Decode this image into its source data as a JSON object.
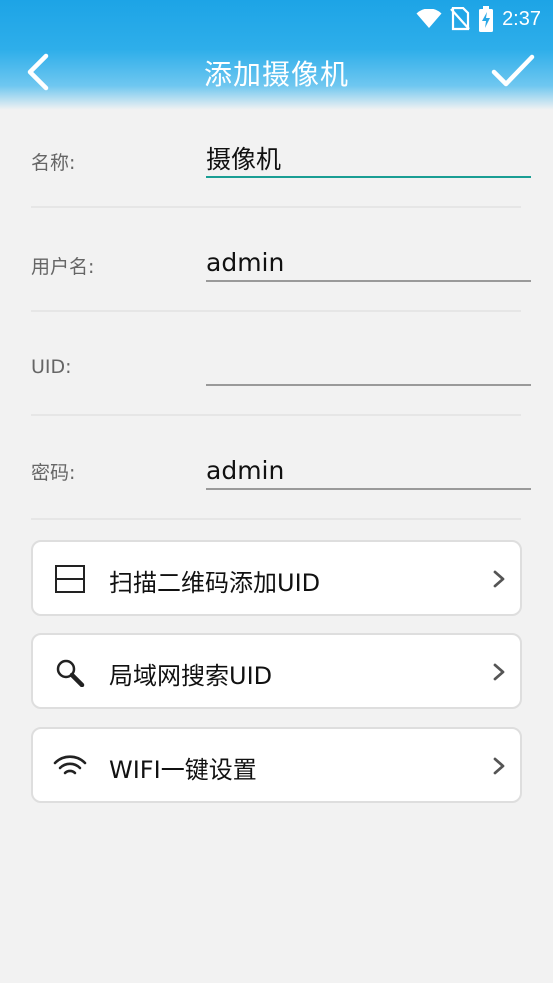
{
  "status_bar": {
    "time": "2:37",
    "icons": [
      "wifi-icon",
      "no-sim-icon",
      "battery-charging-icon"
    ]
  },
  "titlebar": {
    "title": "添加摄像机",
    "back_icon": "back-chevron-icon",
    "confirm_icon": "checkmark-icon"
  },
  "form": {
    "name": {
      "label": "名称:",
      "value": "摄像机"
    },
    "username": {
      "label": "用户名:",
      "value": "admin"
    },
    "uid": {
      "label": "UID:",
      "value": ""
    },
    "password": {
      "label": "密码:",
      "value": "admin"
    }
  },
  "actions": [
    {
      "label": "扫描二维码添加UID",
      "icon": "scan-qr-icon"
    },
    {
      "label": "局域网搜索UID",
      "icon": "search-icon"
    },
    {
      "label": "WIFI一键设置",
      "icon": "wifi-icon"
    }
  ],
  "colors": {
    "header": "#1da4e6",
    "focus_underline": "#1a9e94",
    "background": "#f2f2f2"
  }
}
